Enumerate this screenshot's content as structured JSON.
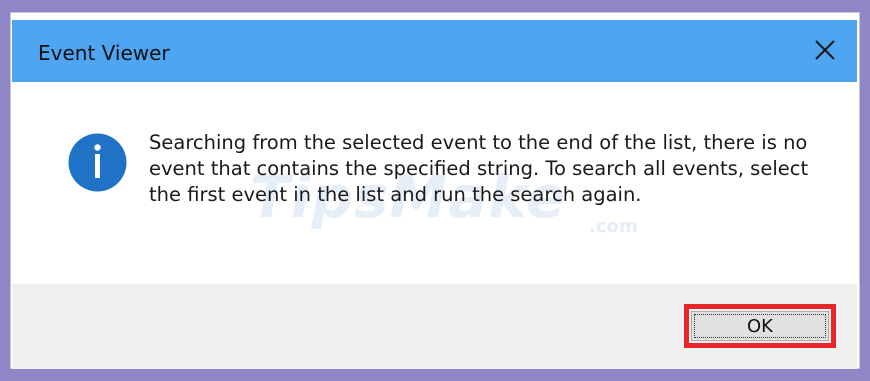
{
  "window": {
    "title": "Event Viewer",
    "close_icon": "close-icon"
  },
  "message": {
    "icon": "info-icon",
    "text": "Searching from the selected event to the end of the list, there is no event that contains the specified string. To search all events, select the first event in the list and run the search again."
  },
  "watermark": {
    "brand": "TipsMake",
    "domain": ".com"
  },
  "buttons": {
    "ok_label": "OK"
  },
  "colors": {
    "titlebar": "#4ea5f2",
    "info_icon": "#1f72c5",
    "highlight": "#e8262a",
    "footer": "#f0f0f0",
    "backdrop": "#8e86c6"
  }
}
